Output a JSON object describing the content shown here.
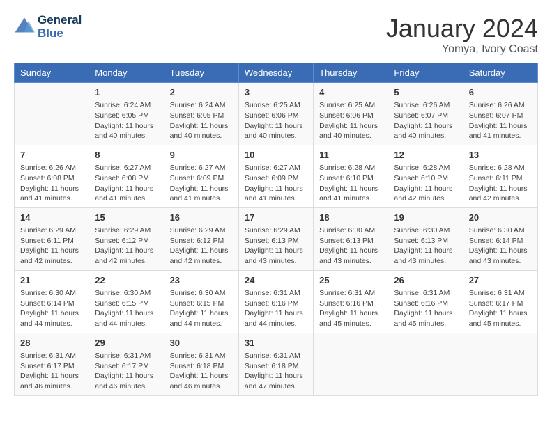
{
  "header": {
    "logo_line1": "General",
    "logo_line2": "Blue",
    "month": "January 2024",
    "location": "Yomya, Ivory Coast"
  },
  "weekdays": [
    "Sunday",
    "Monday",
    "Tuesday",
    "Wednesday",
    "Thursday",
    "Friday",
    "Saturday"
  ],
  "weeks": [
    [
      {
        "day": "",
        "info": ""
      },
      {
        "day": "1",
        "info": "Sunrise: 6:24 AM\nSunset: 6:05 PM\nDaylight: 11 hours\nand 40 minutes."
      },
      {
        "day": "2",
        "info": "Sunrise: 6:24 AM\nSunset: 6:05 PM\nDaylight: 11 hours\nand 40 minutes."
      },
      {
        "day": "3",
        "info": "Sunrise: 6:25 AM\nSunset: 6:06 PM\nDaylight: 11 hours\nand 40 minutes."
      },
      {
        "day": "4",
        "info": "Sunrise: 6:25 AM\nSunset: 6:06 PM\nDaylight: 11 hours\nand 40 minutes."
      },
      {
        "day": "5",
        "info": "Sunrise: 6:26 AM\nSunset: 6:07 PM\nDaylight: 11 hours\nand 40 minutes."
      },
      {
        "day": "6",
        "info": "Sunrise: 6:26 AM\nSunset: 6:07 PM\nDaylight: 11 hours\nand 41 minutes."
      }
    ],
    [
      {
        "day": "7",
        "info": "Sunrise: 6:26 AM\nSunset: 6:08 PM\nDaylight: 11 hours\nand 41 minutes."
      },
      {
        "day": "8",
        "info": "Sunrise: 6:27 AM\nSunset: 6:08 PM\nDaylight: 11 hours\nand 41 minutes."
      },
      {
        "day": "9",
        "info": "Sunrise: 6:27 AM\nSunset: 6:09 PM\nDaylight: 11 hours\nand 41 minutes."
      },
      {
        "day": "10",
        "info": "Sunrise: 6:27 AM\nSunset: 6:09 PM\nDaylight: 11 hours\nand 41 minutes."
      },
      {
        "day": "11",
        "info": "Sunrise: 6:28 AM\nSunset: 6:10 PM\nDaylight: 11 hours\nand 41 minutes."
      },
      {
        "day": "12",
        "info": "Sunrise: 6:28 AM\nSunset: 6:10 PM\nDaylight: 11 hours\nand 42 minutes."
      },
      {
        "day": "13",
        "info": "Sunrise: 6:28 AM\nSunset: 6:11 PM\nDaylight: 11 hours\nand 42 minutes."
      }
    ],
    [
      {
        "day": "14",
        "info": "Sunrise: 6:29 AM\nSunset: 6:11 PM\nDaylight: 11 hours\nand 42 minutes."
      },
      {
        "day": "15",
        "info": "Sunrise: 6:29 AM\nSunset: 6:12 PM\nDaylight: 11 hours\nand 42 minutes."
      },
      {
        "day": "16",
        "info": "Sunrise: 6:29 AM\nSunset: 6:12 PM\nDaylight: 11 hours\nand 42 minutes."
      },
      {
        "day": "17",
        "info": "Sunrise: 6:29 AM\nSunset: 6:13 PM\nDaylight: 11 hours\nand 43 minutes."
      },
      {
        "day": "18",
        "info": "Sunrise: 6:30 AM\nSunset: 6:13 PM\nDaylight: 11 hours\nand 43 minutes."
      },
      {
        "day": "19",
        "info": "Sunrise: 6:30 AM\nSunset: 6:13 PM\nDaylight: 11 hours\nand 43 minutes."
      },
      {
        "day": "20",
        "info": "Sunrise: 6:30 AM\nSunset: 6:14 PM\nDaylight: 11 hours\nand 43 minutes."
      }
    ],
    [
      {
        "day": "21",
        "info": "Sunrise: 6:30 AM\nSunset: 6:14 PM\nDaylight: 11 hours\nand 44 minutes."
      },
      {
        "day": "22",
        "info": "Sunrise: 6:30 AM\nSunset: 6:15 PM\nDaylight: 11 hours\nand 44 minutes."
      },
      {
        "day": "23",
        "info": "Sunrise: 6:30 AM\nSunset: 6:15 PM\nDaylight: 11 hours\nand 44 minutes."
      },
      {
        "day": "24",
        "info": "Sunrise: 6:31 AM\nSunset: 6:16 PM\nDaylight: 11 hours\nand 44 minutes."
      },
      {
        "day": "25",
        "info": "Sunrise: 6:31 AM\nSunset: 6:16 PM\nDaylight: 11 hours\nand 45 minutes."
      },
      {
        "day": "26",
        "info": "Sunrise: 6:31 AM\nSunset: 6:16 PM\nDaylight: 11 hours\nand 45 minutes."
      },
      {
        "day": "27",
        "info": "Sunrise: 6:31 AM\nSunset: 6:17 PM\nDaylight: 11 hours\nand 45 minutes."
      }
    ],
    [
      {
        "day": "28",
        "info": "Sunrise: 6:31 AM\nSunset: 6:17 PM\nDaylight: 11 hours\nand 46 minutes."
      },
      {
        "day": "29",
        "info": "Sunrise: 6:31 AM\nSunset: 6:17 PM\nDaylight: 11 hours\nand 46 minutes."
      },
      {
        "day": "30",
        "info": "Sunrise: 6:31 AM\nSunset: 6:18 PM\nDaylight: 11 hours\nand 46 minutes."
      },
      {
        "day": "31",
        "info": "Sunrise: 6:31 AM\nSunset: 6:18 PM\nDaylight: 11 hours\nand 47 minutes."
      },
      {
        "day": "",
        "info": ""
      },
      {
        "day": "",
        "info": ""
      },
      {
        "day": "",
        "info": ""
      }
    ]
  ]
}
